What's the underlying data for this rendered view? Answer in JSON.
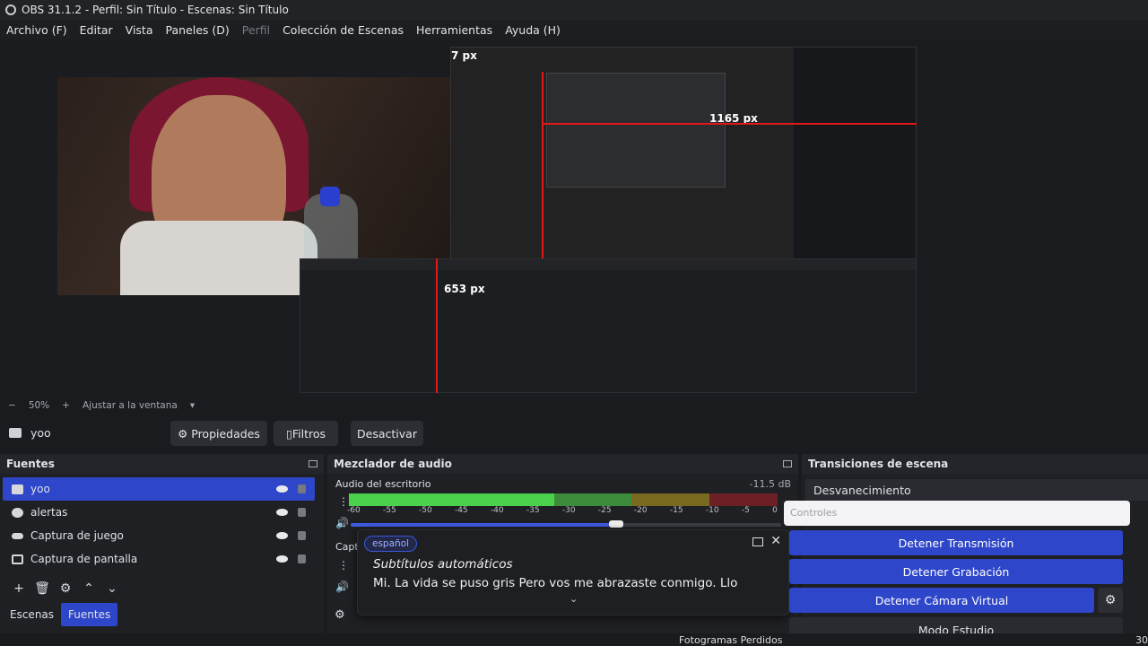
{
  "window": {
    "title": "OBS 31.1.2 - Perfil: Sin Título - Escenas: Sin Título"
  },
  "menu": [
    {
      "label": "Archivo (F)",
      "disabled": false
    },
    {
      "label": "Editar",
      "disabled": false
    },
    {
      "label": "Vista",
      "disabled": false
    },
    {
      "label": "Paneles (D)",
      "disabled": false
    },
    {
      "label": "Perfil",
      "disabled": true
    },
    {
      "label": "Colección de Escenas",
      "disabled": false
    },
    {
      "label": "Herramientas",
      "disabled": false
    },
    {
      "label": "Ayuda (H)",
      "disabled": false
    }
  ],
  "preview": {
    "measure_1165": "1165 px",
    "measure_653": "653 px",
    "measure_top": "7 px"
  },
  "zoom": {
    "minus": "−",
    "value": "50%",
    "plus": "+",
    "fit": "Ajustar a la ventana",
    "caret": "▾"
  },
  "source_bar": {
    "source_name": "yoo",
    "properties": "Propiedades",
    "filters": "Filtros",
    "deactivate": "Desactivar"
  },
  "sources_dock": {
    "title": "Fuentes",
    "items": [
      {
        "label": "yoo",
        "selected": true,
        "icon": "camera-icon"
      },
      {
        "label": "alertas",
        "selected": false,
        "icon": "globe-icon"
      },
      {
        "label": "Captura de juego",
        "selected": false,
        "icon": "gamepad-icon"
      },
      {
        "label": "Captura de pantalla",
        "selected": false,
        "icon": "monitor-icon"
      }
    ],
    "tabs": {
      "scenes": "Escenas",
      "sources": "Fuentes"
    }
  },
  "mixer_dock": {
    "title": "Mezclador de audio",
    "track_name": "Audio del escritorio",
    "track_db": "-11.5 dB",
    "second_track": "Capt",
    "ticks": [
      "-60",
      "-55",
      "-50",
      "-45",
      "-40",
      "-35",
      "-30",
      "-25",
      "-20",
      "-15",
      "-10",
      "-5",
      "0"
    ],
    "volume_fraction": 0.62
  },
  "captions": {
    "language": "español",
    "title": "Subtítulos automáticos",
    "text": "Mi. La vida se puso gris Pero vos me abrazaste conmigo. Llo",
    "chevron": "⌄"
  },
  "transitions_dock": {
    "title": "Transiciones de escena",
    "selected": "Desvanecimiento"
  },
  "controls": {
    "placeholder": "Controles",
    "stop_stream": "Detener Transmisión",
    "stop_record": "Detener Grabación",
    "stop_vcam": "Detener Cámara Virtual",
    "studio_mode": "Modo Estudio"
  },
  "status": {
    "dropped": "Fotogramas Perdidos",
    "fps": "30"
  },
  "colors": {
    "accent": "#2e46c9",
    "meter_green": "#4bd14b",
    "guide_red": "#e01818"
  }
}
